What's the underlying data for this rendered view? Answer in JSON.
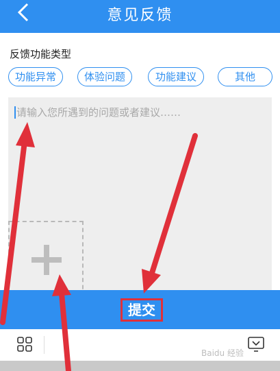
{
  "header": {
    "title": "意见反馈",
    "back_icon": "chevron-left-icon"
  },
  "feedback_type": {
    "label": "反馈功能类型",
    "tags": [
      "功能异常",
      "体验问题",
      "功能建议",
      "其他"
    ]
  },
  "feedback": {
    "placeholder": "请输入您所遇到的问题或者建议……"
  },
  "add_image": {
    "icon": "plus-icon"
  },
  "submit": {
    "label": "提交"
  },
  "toolbar": {
    "left_icon": "grid-icon",
    "right_icon": "keyboard-collapse-icon"
  },
  "watermark": {
    "text": "Baidu 经验"
  },
  "colors": {
    "accent": "#2f8ff0",
    "annotation": "#e0303a"
  }
}
